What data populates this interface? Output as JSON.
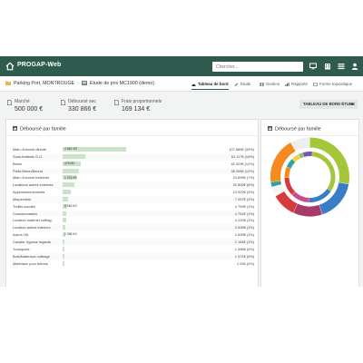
{
  "topbar": {
    "brand": "PROGAP-Web",
    "search_placeholder": "Chercher...",
    "icons": [
      "home-icon",
      "monitor-icon",
      "building-icon",
      "list-icon",
      "user-icon"
    ]
  },
  "breadcrumb": {
    "project": "Parking Port, MONTROUGE",
    "study": "Etude de prix MC1900 (demo)"
  },
  "tabs": [
    {
      "label": "Tableau de bord",
      "active": true
    },
    {
      "label": "Etude",
      "active": false
    },
    {
      "label": "Gestion",
      "active": false
    },
    {
      "label": "Rapports",
      "active": false
    },
    {
      "label": "Forme expositique",
      "active": false
    }
  ],
  "kpis": [
    {
      "label": "Marché",
      "value": "500 000 €"
    },
    {
      "label": "Déboursé sec",
      "value": "330 866 €"
    },
    {
      "label": "Frais proportionnels",
      "value": "169 134 €"
    }
  ],
  "view_button": "TABLEAU DE BORD ÉTUDE",
  "left_card": {
    "title": "Déboursé par famille",
    "rows": [
      {
        "label": "Main d'oeuvre directe",
        "bar_text": "4 682 HR",
        "fill": 0.28,
        "value": "107 685€ (33%)"
      },
      {
        "label": "Sous-traitants G.O.",
        "bar_text": "",
        "fill": 0.1,
        "value": "54 117€ (16%)"
      },
      {
        "label": "Béton",
        "bar_text": "475 M3",
        "fill": 0.08,
        "value": "40 323€ (12%)"
      },
      {
        "label": "Préfa Béton/Beurre",
        "bar_text": "",
        "fill": 0.07,
        "value": "38 254€ (12%)"
      },
      {
        "label": "Main d'oeuvre indirecte",
        "bar_text": "1 074 HR",
        "fill": 0.06,
        "value": "24 695€ (7%)"
      },
      {
        "label": "Locations autres externes",
        "bar_text": "",
        "fill": 0.05,
        "value": "20 500€ (6%)"
      },
      {
        "label": "Approvisionnements",
        "bar_text": "",
        "fill": 0.035,
        "value": "10 920€ (3%)"
      },
      {
        "label": "Maçonnerie",
        "bar_text": "",
        "fill": 0.025,
        "value": "7 057€ (2%)"
      },
      {
        "label": "Treillis soudés",
        "bar_text": "5 945 KG",
        "fill": 0.018,
        "value": "4 759€ (1%)"
      },
      {
        "label": "Consommables",
        "bar_text": "",
        "fill": 0.016,
        "value": "4 751€ (1%)"
      },
      {
        "label": "Location matériel coffrag.",
        "bar_text": "",
        "fill": 0.014,
        "value": "4 220€ (1%)"
      },
      {
        "label": "Location autres internes",
        "bar_text": "",
        "fill": 0.012,
        "value": "3 535€ (1%)"
      },
      {
        "label": "Aciers HA",
        "bar_text": "2 398 KG",
        "fill": 0.012,
        "value": "2 839€ (1%)"
      },
      {
        "label": "Canalis. hypaus regards",
        "bar_text": "",
        "fill": 0.009,
        "value": "2 184€ (1%)"
      },
      {
        "label": "Transports",
        "bar_text": "",
        "fill": 0.006,
        "value": "1 596€ (0%)"
      },
      {
        "label": "Bois/Matériaux coffrage",
        "bar_text": "",
        "fill": 0.005,
        "value": "1 572€ (0%)"
      },
      {
        "label": "Matériaux pour bétons",
        "bar_text": "",
        "fill": 0.004,
        "value": "1 095 (0%)"
      }
    ]
  },
  "right_card": {
    "title": "Déboursé par famille",
    "donut_outer": [
      {
        "value": 0.28,
        "color": "#a4c639"
      },
      {
        "value": 0.17,
        "color": "#3b7dc4"
      },
      {
        "value": 0.12,
        "color": "#a83a68"
      },
      {
        "value": 0.1,
        "color": "#d63a3a"
      },
      {
        "value": 0.04,
        "color": "#f7f7f7"
      },
      {
        "value": 0.02,
        "color": "#2fa3a0"
      },
      {
        "value": 0.19,
        "color": "#f58a1f"
      },
      {
        "value": 0.08,
        "color": "#eeeeee"
      }
    ],
    "donut_inner": [
      {
        "value": 0.33,
        "color": "#a4c639"
      },
      {
        "value": 0.16,
        "color": "#3b7dc4"
      },
      {
        "value": 0.12,
        "color": "#c94b8a"
      },
      {
        "value": 0.12,
        "color": "#d63a3a"
      },
      {
        "value": 0.07,
        "color": "#f58a1f"
      },
      {
        "value": 0.06,
        "color": "#2fa3a0"
      },
      {
        "value": 0.05,
        "color": "#f7d040"
      },
      {
        "value": 0.03,
        "color": "#8cc06d"
      },
      {
        "value": 0.06,
        "color": "#7a56b0"
      }
    ]
  }
}
